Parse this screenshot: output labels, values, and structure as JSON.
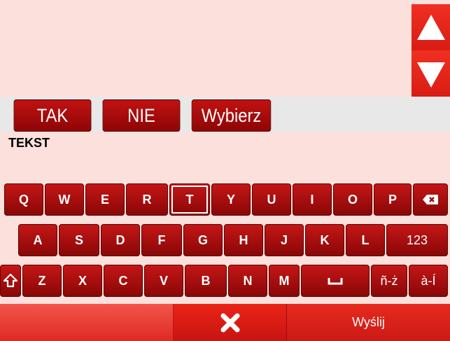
{
  "answers": {
    "yes_label": "TAK",
    "no_label": "NIE",
    "choose_label": "Wybierz"
  },
  "input": {
    "text": "TEKST"
  },
  "keyboard": {
    "row1": [
      "Q",
      "W",
      "E",
      "R",
      "T",
      "Y",
      "U",
      "I",
      "O",
      "P"
    ],
    "row2": [
      "A",
      "S",
      "D",
      "F",
      "G",
      "H",
      "J",
      "K",
      "L"
    ],
    "row3": [
      "Z",
      "X",
      "C",
      "V",
      "B",
      "N",
      "M"
    ],
    "numbers_label": "123",
    "accents_label1": "ñ-ż",
    "accents_label2": "à-Í",
    "active_key": "T"
  },
  "footer": {
    "send_label": "Wyślij"
  },
  "colors": {
    "background": "#fbe0dc",
    "key": "#b30f0f",
    "accent": "#e3231a"
  },
  "icons": [
    "arrow-up-icon",
    "arrow-down-icon",
    "backspace-icon",
    "shift-icon",
    "space-icon",
    "close-icon"
  ]
}
